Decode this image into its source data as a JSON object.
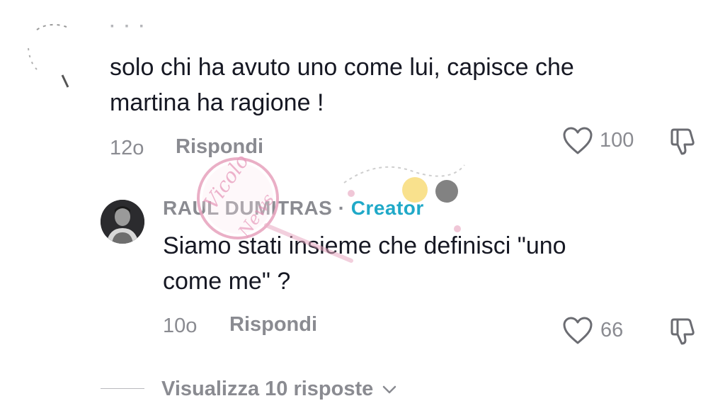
{
  "comment": {
    "text_line1": "solo chi ha avuto uno come lui, capisce che",
    "text_line2": "martina ha ragione !",
    "age": "12o",
    "reply_label": "Rispondi",
    "likes": "100",
    "icons": {
      "like": "heart-outline-icon",
      "dislike": "thumbs-down-icon"
    }
  },
  "reply": {
    "username": "RAUL DUMITRAS",
    "separator": "·",
    "badge": "Creator",
    "text_line1": "Siamo stati insieme che definisci \"uno",
    "text_line2": "come me\" ?",
    "age": "10o",
    "reply_label": "Rispondi",
    "likes": "66",
    "icons": {
      "like": "heart-outline-icon",
      "dislike": "thumbs-down-icon"
    }
  },
  "view_replies": {
    "label": "Visualizza 10 risposte",
    "icon": "chevron-down-icon"
  },
  "watermark": {
    "logo_text_top": "Vicolo",
    "logo_text_bottom": "News"
  },
  "colors": {
    "text": "#161823",
    "muted": "#8a8b91",
    "creator": "#20a9c8",
    "watermark_pink": "#e8a7c0"
  }
}
